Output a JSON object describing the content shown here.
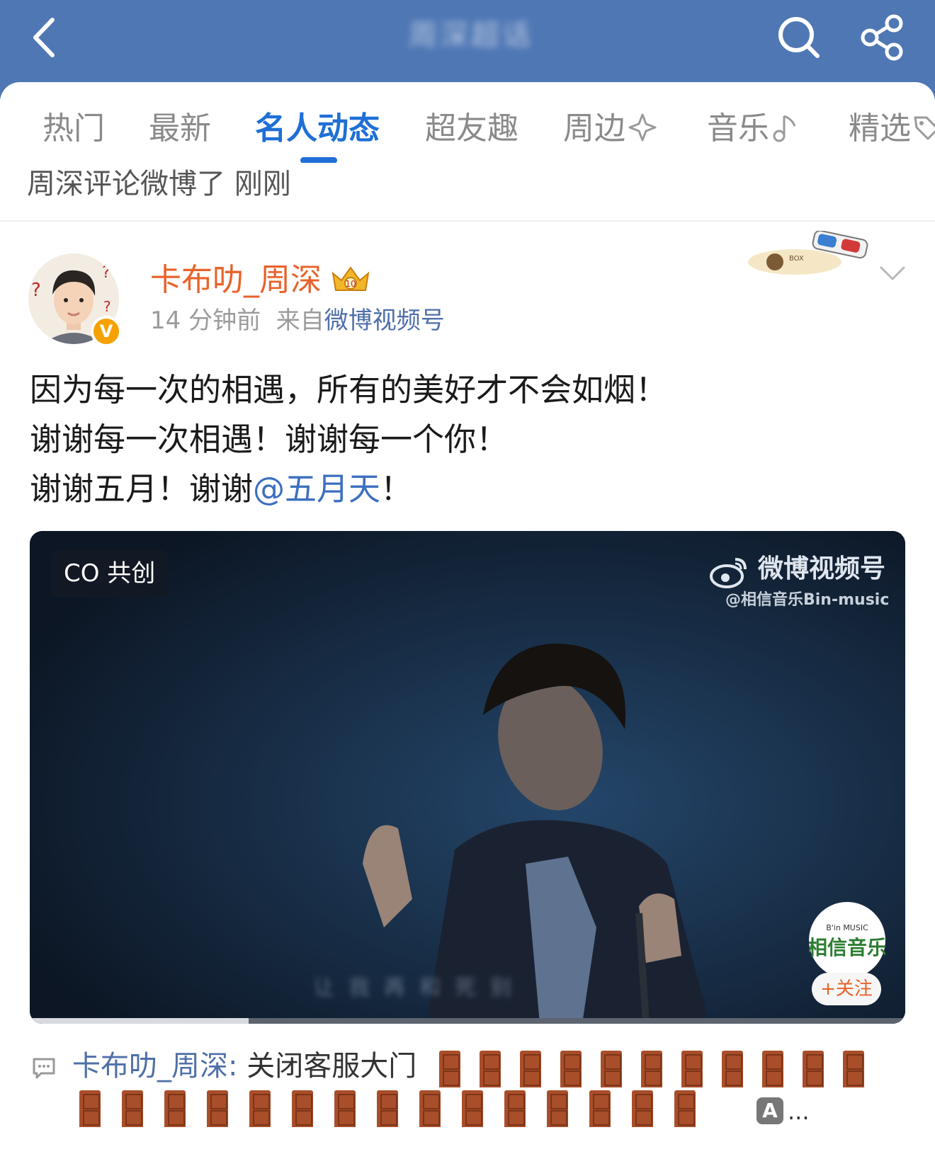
{
  "header": {
    "title": "周深超话",
    "back_icon": "back-chevron-icon",
    "search_icon": "search-icon",
    "share_icon": "share-icon",
    "bar_color": "#4f77b4"
  },
  "tabs": [
    {
      "label": "热门",
      "active": false
    },
    {
      "label": "最新",
      "active": false
    },
    {
      "label": "名人动态",
      "active": true
    },
    {
      "label": "超友趣",
      "active": false
    },
    {
      "label": "周边",
      "active": false,
      "icon": "sparkle-icon"
    },
    {
      "label": "音乐",
      "active": false,
      "icon": "music-note-icon"
    },
    {
      "label": "精选",
      "active": false,
      "icon": "tag-icon"
    }
  ],
  "activity_line": "周深评论微博了 刚刚",
  "post": {
    "username": "卡布叻_周深",
    "verified_badge": "V",
    "time": "14 分钟前",
    "source_prefix": "来自",
    "source": "微博视频号",
    "lines": [
      "因为每一次的相遇，所有的美好才不会如烟！",
      "谢谢每一次相遇！谢谢每一个你！"
    ],
    "line3_prefix": "谢谢五月！谢谢",
    "mention": "@五月天",
    "line3_suffix": "！",
    "name_color": "#e8622a",
    "link_color": "#3c6fbf"
  },
  "video": {
    "cocreate_label": "CO 共创",
    "watermark_title": "微博视频号",
    "watermark_account": "@相信音乐Bin-music",
    "channel_logo_text": "相信音乐",
    "follow_label": "+关注",
    "progress": 0.25
  },
  "comment": {
    "user": "卡布叻_周深",
    "separator": ": ",
    "text": "关闭客服大门",
    "emoji": "door-emoji",
    "emoji_count": 26,
    "ellipsis": "..."
  }
}
